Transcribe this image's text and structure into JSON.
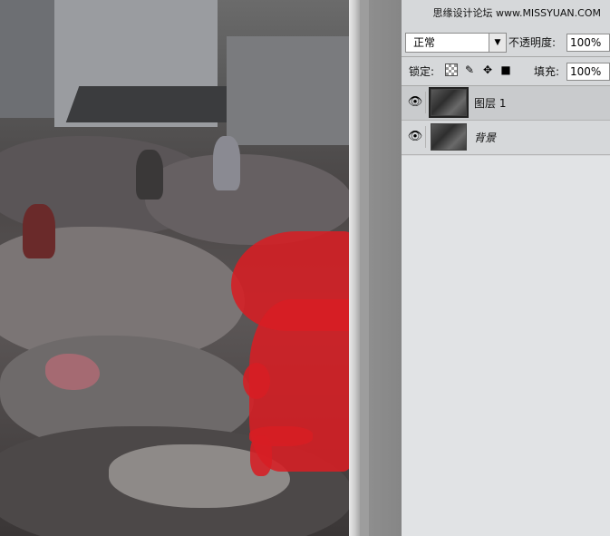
{
  "watermark": "思缘设计论坛 www.MISSYUAN.COM",
  "layers_panel": {
    "blend_mode": "正常",
    "opacity_label": "不透明度:",
    "opacity_value": "100%",
    "lock_label": "锁定:",
    "fill_label": "填充:",
    "fill_value": "100%",
    "lock_icons": [
      "lock-transparent-icon",
      "lock-brush-icon",
      "lock-move-icon",
      "lock-all-icon"
    ],
    "layers": [
      {
        "name": "图层 1",
        "visible": true,
        "selected": true
      },
      {
        "name": "背景",
        "visible": true,
        "selected": false,
        "italic": true
      }
    ]
  },
  "colors": {
    "mask_red": "#d71e23",
    "panel_bg": "#d6d8da"
  }
}
